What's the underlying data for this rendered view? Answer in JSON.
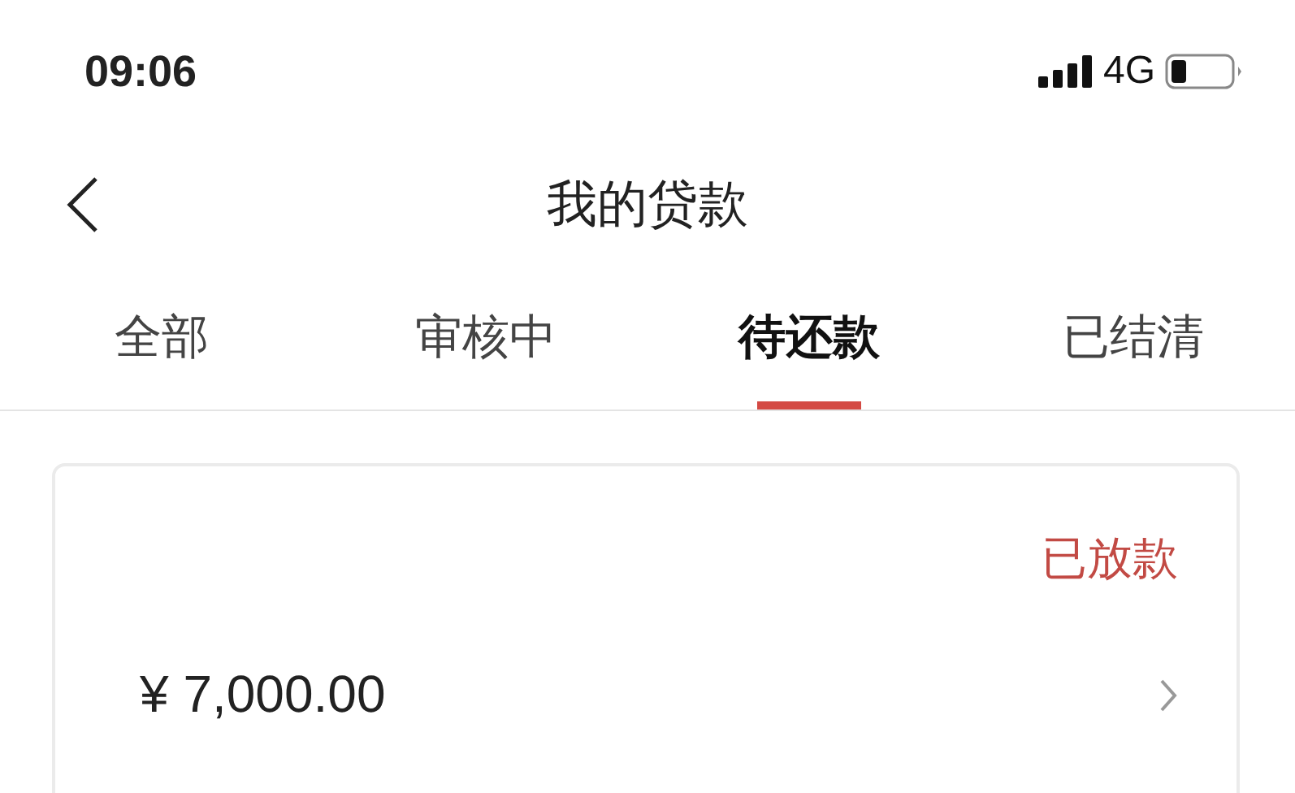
{
  "status_bar": {
    "time": "09:06",
    "network": "4G"
  },
  "nav_bar": {
    "title": "我的贷款"
  },
  "tabs": [
    {
      "label": "全部",
      "selected": false
    },
    {
      "label": "审核中",
      "selected": false
    },
    {
      "label": "待还款",
      "selected": true
    },
    {
      "label": "已结清",
      "selected": false
    }
  ],
  "loans": [
    {
      "status": "已放款",
      "amount": "¥ 7,000.00"
    }
  ]
}
